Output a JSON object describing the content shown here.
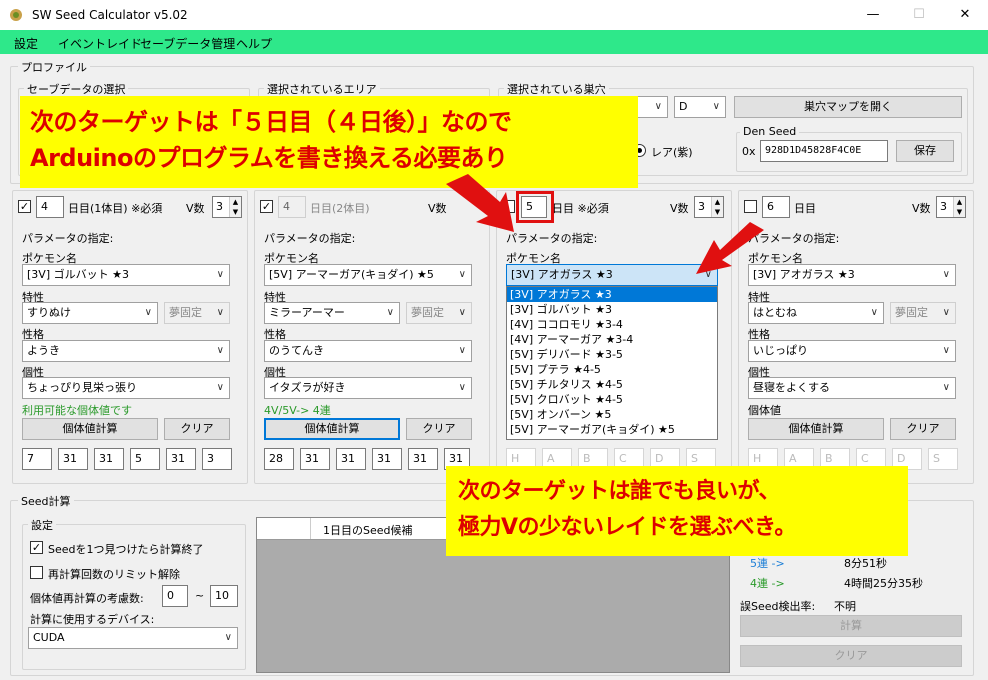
{
  "window": {
    "title": "SW Seed Calculator v5.02",
    "minimize": "—",
    "maximize": "☐",
    "close": "✕"
  },
  "menu": [
    "設定",
    "イベントレイド",
    "セーブデータ管理",
    "ヘルプ"
  ],
  "profile": {
    "group_label": "プロファイル",
    "save_select_label": "セーブデータの選択",
    "area_label": "選択されているエリア",
    "den_label": "選択されている巣穴",
    "den_letter": "D",
    "den_map_button": "巣穴マップを開く",
    "rare_label": "レア(紫)",
    "den_seed_label": "Den Seed",
    "den_seed_prefix": "0x",
    "den_seed_value": "928D1D45828F4C0E",
    "save_button": "保存"
  },
  "colors": {
    "accent_menu": "#2ee88a",
    "callout_bg": "#ffff00",
    "callout_text": "#dd0000",
    "annotation_box": "#e01010",
    "selection": "#0078d7"
  },
  "common": {
    "param_label": "パラメータの指定:",
    "pokemon_label": "ポケモン名",
    "ability_label": "特性",
    "nature_label": "性格",
    "personality_label": "個性",
    "ivs_label": "個体値",
    "vcount_label": "V数",
    "iv_calc_button": "個体値計算",
    "clear_button": "クリア",
    "dream_fixed": "夢固定"
  },
  "columns": [
    {
      "checked": true,
      "day": "4",
      "day_label": "日目(1体目) ※必須",
      "v": "3",
      "pokemon": "[3V] ゴルバット ★3",
      "ability": "すりぬけ",
      "nature": "ようき",
      "personality": "ちょっぴり見栄っ張り",
      "status": "利用可能な個体値です",
      "ivs": [
        "7",
        "31",
        "31",
        "5",
        "31",
        "3"
      ]
    },
    {
      "checked": true,
      "day": "4",
      "day_label": "日目(2体目)",
      "v_label": "V数",
      "pokemon": "[5V] アーマーガア(キョダイ) ★5",
      "ability": "ミラーアーマー",
      "nature": "のうてんき",
      "personality": "イタズラが好き",
      "status": "4V/5V-> 4連",
      "ivs": [
        "28",
        "31",
        "31",
        "31",
        "31",
        "31"
      ]
    },
    {
      "checked": false,
      "day": "5",
      "day_label": "日目 ※必須",
      "v": "3",
      "pokemon": "[3V] アオガラス ★3",
      "ivs_ph": [
        "H",
        "A",
        "B",
        "C",
        "D",
        "S"
      ]
    },
    {
      "checked": false,
      "day": "6",
      "day_label": "日目",
      "v": "3",
      "pokemon": "[3V] アオガラス ★3",
      "ability": "はとむね",
      "nature": "いじっぱり",
      "personality": "昼寝をよくする",
      "ivs_ph": [
        "H",
        "A",
        "B",
        "C",
        "D",
        "S"
      ]
    }
  ],
  "dropdown_items": [
    "[3V] アオガラス ★3",
    "[3V] ゴルバット ★3",
    "[4V] ココロモリ ★3-4",
    "[4V] アーマーガア ★3-4",
    "[5V] デリバード ★3-5",
    "[5V] プテラ ★4-5",
    "[5V] チルタリス ★4-5",
    "[5V] クロバット ★4-5",
    "[5V] オンバーン ★5",
    "[5V] アーマーガア(キョダイ) ★5"
  ],
  "seed_calc": {
    "group_label": "Seed計算",
    "settings_label": "設定",
    "stop_on_found": "Seedを1つ見つけたら計算終了",
    "unlimit": "再計算回数のリミット解除",
    "iv_recalc_label": "個体値再計算の考慮数:",
    "range_from": "0",
    "range_tilde": "~",
    "range_to": "10",
    "device_label": "計算に使用するデバイス:",
    "device": "CUDA",
    "grid_header": "1日目のSeed候補",
    "est_paren": ")",
    "row5_label": "5連 ->",
    "row5_time": "8分51秒",
    "row4_label": "4連 ->",
    "row4_time": "4時間25分35秒",
    "false_rate_label": "誤Seed検出率:",
    "false_rate_value": "不明",
    "calc_button": "計算",
    "clear_button": "クリア"
  },
  "annotations": {
    "top_line1": "次のターゲットは「５日目（４日後）」なので",
    "top_line2": "Arduinoのプログラムを書き換える必要あり",
    "bottom_line1": "次のターゲットは誰でも良いが、",
    "bottom_line2": "極力Vの少ないレイドを選ぶべき。"
  }
}
